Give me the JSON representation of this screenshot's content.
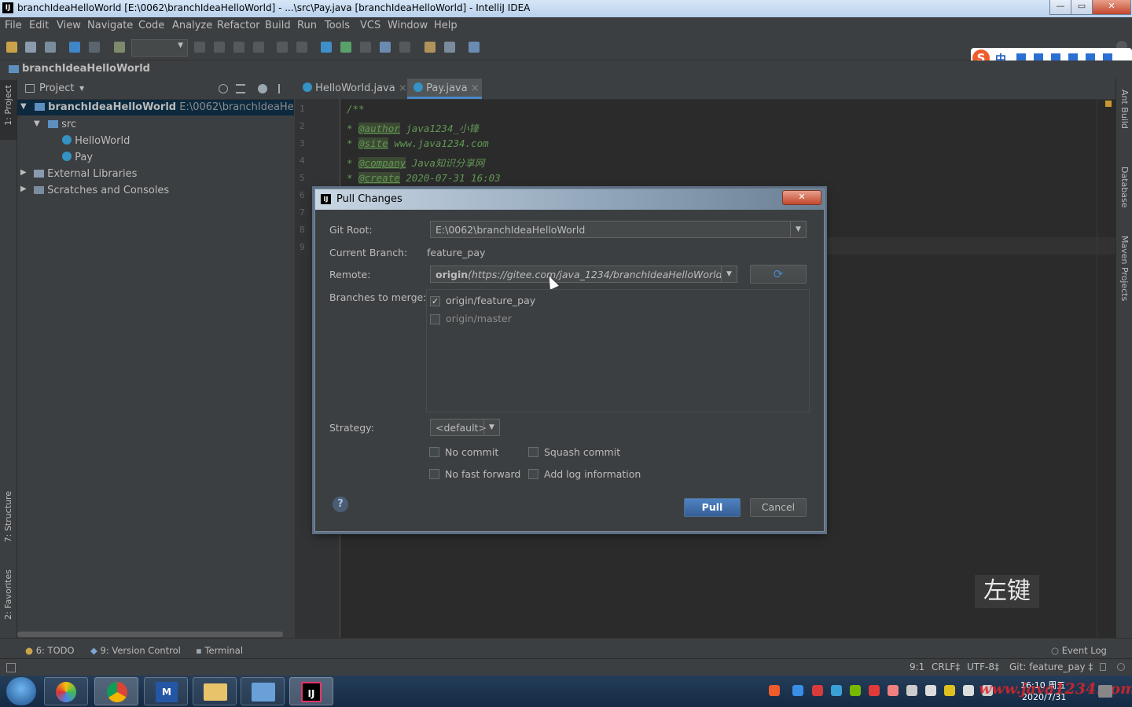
{
  "window": {
    "title": "branchIdeaHelloWorld [E:\\0062\\branchIdeaHelloWorld] - ...\\src\\Pay.java [branchIdeaHelloWorld] - IntelliJ IDEA",
    "logo": "IJ",
    "minimize": "—",
    "maximize": "▭",
    "close": "✕"
  },
  "menu": [
    "File",
    "Edit",
    "View",
    "Navigate",
    "Code",
    "Analyze",
    "Refactor",
    "Build",
    "Run",
    "Tools",
    "VCS",
    "Window",
    "Help"
  ],
  "breadcrumb": "branchIdeaHelloWorld",
  "project_panel": {
    "title": "Project",
    "root_name": "branchIdeaHelloWorld",
    "root_path": "E:\\0062\\branchIdeaHelloWor",
    "src": "src",
    "file1": "HelloWorld",
    "file2": "Pay",
    "external": "External Libraries",
    "scratches": "Scratches and Consoles"
  },
  "left_stripe": {
    "project": "1: Project",
    "structure": "7: Structure",
    "favorites": "2: Favorites"
  },
  "right_stripe": {
    "ant": "Ant Build",
    "database": "Database",
    "maven": "Maven Projects"
  },
  "tabs": [
    {
      "label": "HelloWorld.java",
      "close": "×"
    },
    {
      "label": "Pay.java",
      "close": "×"
    }
  ],
  "code": {
    "line_numbers": [
      "1",
      "2",
      "3",
      "4",
      "5",
      "6",
      "7",
      "8",
      "9"
    ],
    "l1": "/**",
    "l2_tag": "@author",
    "l2_text": " java1234_小锋",
    "l3_tag": "@site",
    "l3_text": " www.java1234.com",
    "l4_tag": "@company",
    "l4_text": " Java知识分享网",
    "l5_tag": "@create",
    "l5_text": " 2020-07-31 16:03",
    "star": " * "
  },
  "dialog": {
    "title": "Pull Changes",
    "close": "✕",
    "git_root_label": "Git Root:",
    "git_root_value": "E:\\0062\\branchIdeaHelloWorld",
    "branch_label": "Current Branch:",
    "branch_value": "feature_pay",
    "remote_label": "Remote:",
    "remote_name": "origin",
    "remote_url": "(https://gitee.com/java_1234/branchIdeaHelloWorld.git)",
    "branches_label": "Branches to merge:",
    "branches": [
      {
        "name": "origin/feature_pay",
        "checked": true
      },
      {
        "name": "origin/master",
        "checked": false
      }
    ],
    "strategy_label": "Strategy:",
    "strategy_value": "<default>",
    "options": {
      "no_commit": "No commit",
      "squash_commit": "Squash commit",
      "no_fast_forward": "No fast forward",
      "add_log": "Add log information"
    },
    "help": "?",
    "pull": "Pull",
    "cancel": "Cancel",
    "dropdown_arrow": "▼",
    "refresh": "⟳"
  },
  "overlay_text": "左键",
  "bottom_tools": {
    "todo": "6: TODO",
    "vcs": "9: Version Control",
    "terminal": "Terminal",
    "event_log": "Event Log"
  },
  "status": {
    "position": "9:1",
    "line_sep": "CRLF‡",
    "encoding": "UTF-8‡",
    "git": "Git: feature_pay ‡"
  },
  "taskbar": {
    "time": "16:10 周五",
    "date": "2020/7/31",
    "watermark": "www.java1234.com"
  },
  "ime": {
    "s": "S",
    "zh": "中"
  }
}
